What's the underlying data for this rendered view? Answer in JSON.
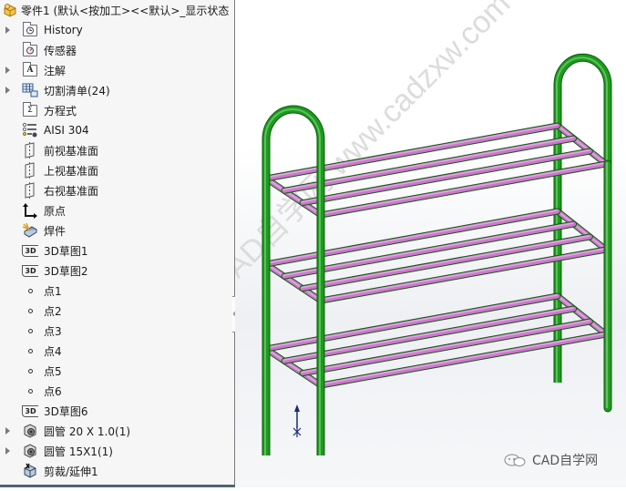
{
  "tree": {
    "root": {
      "label": "零件1  (默认<按加工><<默认>_显示状态",
      "icon": "part-icon"
    },
    "items": [
      {
        "label": "History",
        "icon": "history-folder-icon",
        "expandable": true
      },
      {
        "label": "传感器",
        "icon": "sensors-folder-icon",
        "expandable": false
      },
      {
        "label": "注解",
        "icon": "annotations-folder-icon",
        "expandable": true
      },
      {
        "label": "切割清单(24)",
        "icon": "cut-list-icon",
        "expandable": true
      },
      {
        "label": "方程式",
        "icon": "equations-folder-icon",
        "expandable": false
      },
      {
        "label": "AISI 304",
        "icon": "material-icon",
        "expandable": false
      },
      {
        "label": "前视基准面",
        "icon": "plane-icon",
        "expandable": false
      },
      {
        "label": "上视基准面",
        "icon": "plane-icon",
        "expandable": false
      },
      {
        "label": "右视基准面",
        "icon": "plane-icon",
        "expandable": false
      },
      {
        "label": "原点",
        "icon": "origin-icon",
        "expandable": false
      },
      {
        "label": "焊件",
        "icon": "weldment-icon",
        "expandable": false
      },
      {
        "label": "3D草图1",
        "icon": "3d-sketch-icon",
        "expandable": false
      },
      {
        "label": "3D草图2",
        "icon": "3d-sketch-icon",
        "expandable": false
      },
      {
        "label": "点1",
        "icon": "point-icon",
        "expandable": false
      },
      {
        "label": "点2",
        "icon": "point-icon",
        "expandable": false
      },
      {
        "label": "点3",
        "icon": "point-icon",
        "expandable": false
      },
      {
        "label": "点4",
        "icon": "point-icon",
        "expandable": false
      },
      {
        "label": "点5",
        "icon": "point-icon",
        "expandable": false
      },
      {
        "label": "点6",
        "icon": "point-icon",
        "expandable": false
      },
      {
        "label": "3D草图6",
        "icon": "3d-sketch-icon",
        "expandable": false
      },
      {
        "label": "圆管 20 X 1.0(1)",
        "icon": "structural-member-icon",
        "expandable": true
      },
      {
        "label": "圆管 15X1(1)",
        "icon": "structural-member-icon",
        "expandable": true
      },
      {
        "label": "剪裁/延伸1",
        "icon": "trim-extend-icon",
        "expandable": false
      }
    ]
  },
  "viewport": {
    "model": "shoe-rack",
    "frame_color": "#1e9a1e",
    "rail_color": "#cc77cc",
    "shelves": 3,
    "rails_per_shelf": 4,
    "watermark": "CAD自学网 www.cadzxw.com"
  },
  "brand": {
    "label": "CAD自学网"
  }
}
